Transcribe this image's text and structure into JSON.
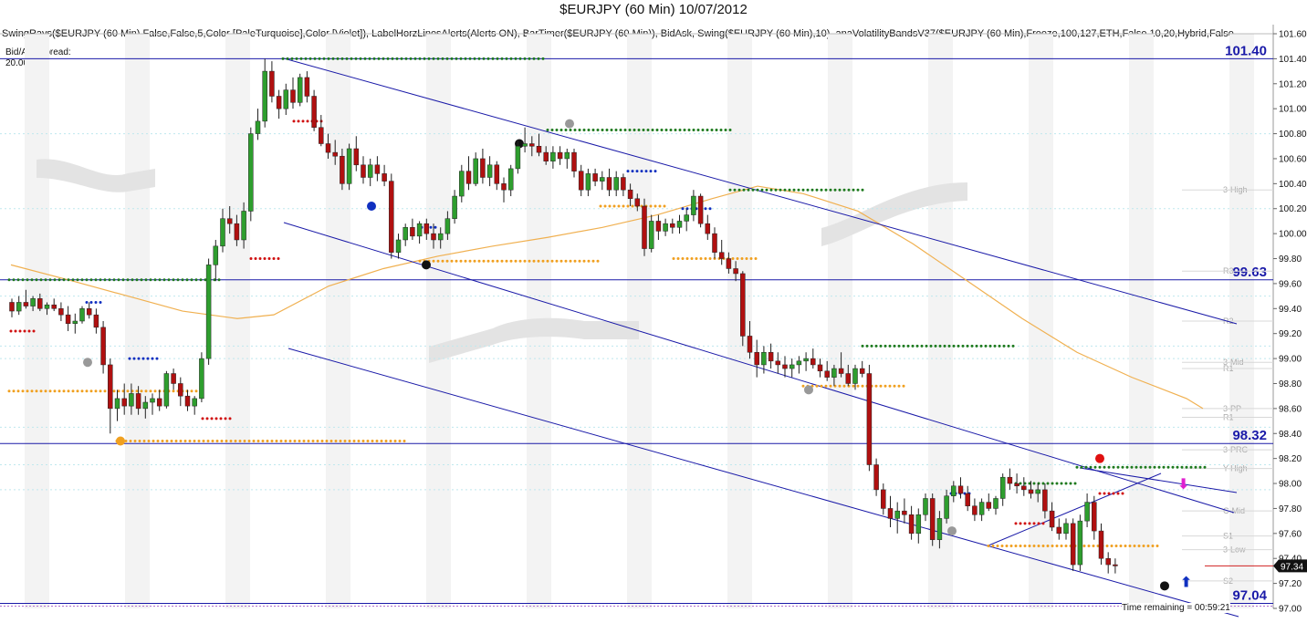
{
  "title": "$EURJPY (60 Min)  10/07/2012",
  "indicators_text": "SwingRays($EURJPY (60 Min),False,False,5,Color [PaleTurquoise],Color [Violet]), LabelHorzLinesAlerts(Alerts ON), BarTimer($EURJPY (60 Min)), BidAsk, Swing($EURJPY (60 Min),10), anaVolatilityBandsV37($EURJPY (60 Min),Freeze,100,127,ETH,False,10,20,Hybrid,False",
  "spread_label": "Bid/Ask Spread:",
  "spread_value": "20.00",
  "time_remaining": "Time remaining = 00:59:21",
  "colors": {
    "up": "#2e9e2e",
    "down": "#b01010",
    "channel": "#1a1aa8",
    "ma": "#f0b050",
    "green_dots": "#1e7a1e",
    "red_dots": "#d01010",
    "blue_dots": "#1030c0",
    "orange_dots": "#f0a020"
  },
  "chart_data": {
    "type": "candlestick",
    "symbol": "$EURJPY",
    "interval": "60 Min",
    "date": "10/07/2012",
    "ylim": [
      97.0,
      101.6
    ],
    "yticks": [
      "101.60",
      "101.40",
      "101.20",
      "101.00",
      "100.80",
      "100.60",
      "100.40",
      "100.20",
      "100.00",
      "99.80",
      "99.60",
      "99.40",
      "99.20",
      "99.00",
      "98.80",
      "98.60",
      "98.40",
      "98.20",
      "98.00",
      "97.80",
      "97.60",
      "97.40",
      "97.20",
      "97.00"
    ],
    "last_price": "97.34",
    "horizontal_levels": [
      {
        "label": "101.40",
        "value": 101.4
      },
      {
        "label": "99.63",
        "value": 99.63
      },
      {
        "label": "98.32",
        "value": 98.32
      },
      {
        "label": "97.04",
        "value": 97.04
      }
    ],
    "pivot_labels": [
      {
        "text": "3-High",
        "value": 100.35
      },
      {
        "text": "R3",
        "value": 99.7
      },
      {
        "text": "R2",
        "value": 99.3
      },
      {
        "text": "3-Mid",
        "value": 98.97
      },
      {
        "text": "R1",
        "value": 98.92
      },
      {
        "text": "3-PP",
        "value": 98.6
      },
      {
        "text": "R1",
        "value": 98.53
      },
      {
        "text": "3-PRC",
        "value": 98.27
      },
      {
        "text": "Y-High",
        "value": 98.12
      },
      {
        "text": "C-Mid",
        "value": 97.78
      },
      {
        "text": "S1",
        "value": 97.58
      },
      {
        "text": "3-Low",
        "value": 97.47
      },
      {
        "text": "S2",
        "value": 97.22
      }
    ],
    "candles": [
      [
        99.45,
        99.48,
        99.33,
        99.38
      ],
      [
        99.38,
        99.5,
        99.35,
        99.45
      ],
      [
        99.45,
        99.55,
        99.4,
        99.42
      ],
      [
        99.42,
        99.5,
        99.38,
        99.48
      ],
      [
        99.48,
        99.52,
        99.38,
        99.4
      ],
      [
        99.4,
        99.45,
        99.35,
        99.43
      ],
      [
        99.43,
        99.48,
        99.38,
        99.4
      ],
      [
        99.4,
        99.45,
        99.3,
        99.35
      ],
      [
        99.35,
        99.42,
        99.22,
        99.28
      ],
      [
        99.28,
        99.36,
        99.2,
        99.3
      ],
      [
        99.3,
        99.42,
        99.28,
        99.4
      ],
      [
        99.4,
        99.45,
        99.32,
        99.35
      ],
      [
        99.35,
        99.4,
        99.2,
        99.25
      ],
      [
        99.25,
        99.3,
        98.88,
        98.95
      ],
      [
        98.95,
        99.0,
        98.4,
        98.6
      ],
      [
        98.6,
        98.75,
        98.5,
        98.68
      ],
      [
        98.68,
        98.8,
        98.55,
        98.62
      ],
      [
        98.62,
        98.8,
        98.55,
        98.72
      ],
      [
        98.72,
        98.78,
        98.55,
        98.6
      ],
      [
        98.6,
        98.7,
        98.52,
        98.65
      ],
      [
        98.65,
        98.72,
        98.55,
        98.68
      ],
      [
        98.68,
        98.75,
        98.58,
        98.62
      ],
      [
        98.62,
        98.9,
        98.6,
        98.88
      ],
      [
        98.88,
        98.92,
        98.75,
        98.8
      ],
      [
        98.8,
        98.85,
        98.62,
        98.7
      ],
      [
        98.7,
        98.75,
        98.58,
        98.62
      ],
      [
        98.62,
        98.7,
        98.55,
        98.68
      ],
      [
        98.68,
        99.05,
        98.65,
        99.0
      ],
      [
        99.0,
        99.8,
        98.95,
        99.75
      ],
      [
        99.75,
        99.95,
        99.62,
        99.9
      ],
      [
        99.9,
        100.2,
        99.85,
        100.12
      ],
      [
        100.12,
        100.22,
        100.0,
        100.08
      ],
      [
        100.08,
        100.15,
        99.9,
        99.95
      ],
      [
        99.95,
        100.25,
        99.88,
        100.18
      ],
      [
        100.18,
        100.85,
        100.1,
        100.8
      ],
      [
        100.8,
        101.0,
        100.75,
        100.9
      ],
      [
        100.9,
        101.4,
        100.85,
        101.3
      ],
      [
        101.3,
        101.38,
        101.05,
        101.1
      ],
      [
        101.1,
        101.15,
        100.92,
        101.0
      ],
      [
        101.0,
        101.2,
        100.95,
        101.15
      ],
      [
        101.15,
        101.25,
        101.0,
        101.05
      ],
      [
        101.05,
        101.28,
        101.02,
        101.25
      ],
      [
        101.25,
        101.3,
        101.05,
        101.1
      ],
      [
        101.1,
        101.15,
        100.82,
        100.85
      ],
      [
        100.85,
        100.95,
        100.7,
        100.72
      ],
      [
        100.72,
        100.8,
        100.6,
        100.65
      ],
      [
        100.65,
        100.75,
        100.55,
        100.62
      ],
      [
        100.62,
        100.68,
        100.35,
        100.4
      ],
      [
        100.4,
        100.72,
        100.35,
        100.68
      ],
      [
        100.68,
        100.78,
        100.5,
        100.55
      ],
      [
        100.55,
        100.62,
        100.4,
        100.45
      ],
      [
        100.45,
        100.6,
        100.38,
        100.55
      ],
      [
        100.55,
        100.62,
        100.42,
        100.48
      ],
      [
        100.48,
        100.55,
        100.38,
        100.42
      ],
      [
        100.42,
        100.48,
        99.8,
        99.85
      ],
      [
        99.85,
        100.0,
        99.8,
        99.95
      ],
      [
        99.95,
        100.08,
        99.9,
        100.05
      ],
      [
        100.05,
        100.12,
        99.95,
        99.98
      ],
      [
        99.98,
        100.1,
        99.92,
        100.08
      ],
      [
        100.08,
        100.12,
        99.95,
        100.0
      ],
      [
        100.0,
        100.08,
        99.88,
        99.95
      ],
      [
        99.95,
        100.05,
        99.88,
        100.0
      ],
      [
        100.0,
        100.18,
        99.95,
        100.12
      ],
      [
        100.12,
        100.35,
        100.08,
        100.3
      ],
      [
        100.3,
        100.55,
        100.25,
        100.5
      ],
      [
        100.5,
        100.62,
        100.35,
        100.4
      ],
      [
        100.4,
        100.65,
        100.38,
        100.6
      ],
      [
        100.6,
        100.68,
        100.4,
        100.45
      ],
      [
        100.45,
        100.62,
        100.38,
        100.55
      ],
      [
        100.55,
        100.58,
        100.35,
        100.4
      ],
      [
        100.4,
        100.45,
        100.25,
        100.35
      ],
      [
        100.35,
        100.55,
        100.3,
        100.52
      ],
      [
        100.52,
        100.75,
        100.48,
        100.7
      ],
      [
        100.7,
        100.85,
        100.65,
        100.72
      ],
      [
        100.72,
        100.78,
        100.62,
        100.7
      ],
      [
        100.7,
        100.8,
        100.62,
        100.65
      ],
      [
        100.65,
        100.7,
        100.55,
        100.58
      ],
      [
        100.58,
        100.7,
        100.52,
        100.65
      ],
      [
        100.65,
        100.7,
        100.55,
        100.6
      ],
      [
        100.6,
        100.68,
        100.52,
        100.65
      ],
      [
        100.65,
        100.68,
        100.45,
        100.5
      ],
      [
        100.5,
        100.55,
        100.3,
        100.35
      ],
      [
        100.35,
        100.52,
        100.3,
        100.48
      ],
      [
        100.48,
        100.52,
        100.38,
        100.42
      ],
      [
        100.42,
        100.5,
        100.35,
        100.45
      ],
      [
        100.45,
        100.52,
        100.3,
        100.35
      ],
      [
        100.35,
        100.5,
        100.3,
        100.45
      ],
      [
        100.45,
        100.48,
        100.3,
        100.35
      ],
      [
        100.35,
        100.4,
        100.22,
        100.28
      ],
      [
        100.28,
        100.32,
        100.18,
        100.22
      ],
      [
        100.22,
        100.28,
        99.82,
        99.88
      ],
      [
        99.88,
        100.15,
        99.85,
        100.1
      ],
      [
        100.1,
        100.15,
        99.95,
        100.02
      ],
      [
        100.02,
        100.12,
        99.98,
        100.08
      ],
      [
        100.08,
        100.12,
        100.0,
        100.05
      ],
      [
        100.05,
        100.15,
        100.0,
        100.1
      ],
      [
        100.1,
        100.2,
        100.02,
        100.15
      ],
      [
        100.15,
        100.35,
        100.1,
        100.3
      ],
      [
        100.3,
        100.32,
        100.05,
        100.08
      ],
      [
        100.08,
        100.15,
        99.95,
        100.0
      ],
      [
        100.0,
        100.05,
        99.8,
        99.85
      ],
      [
        99.85,
        99.95,
        99.75,
        99.8
      ],
      [
        99.8,
        99.85,
        99.68,
        99.72
      ],
      [
        99.72,
        99.78,
        99.62,
        99.68
      ],
      [
        99.68,
        99.7,
        99.1,
        99.18
      ],
      [
        99.18,
        99.3,
        99.0,
        99.05
      ],
      [
        99.05,
        99.15,
        98.85,
        98.95
      ],
      [
        98.95,
        99.1,
        98.88,
        99.05
      ],
      [
        99.05,
        99.12,
        98.92,
        98.98
      ],
      [
        98.98,
        99.05,
        98.88,
        98.95
      ],
      [
        98.95,
        99.02,
        98.85,
        98.92
      ],
      [
        98.92,
        99.0,
        98.85,
        98.95
      ],
      [
        98.95,
        99.02,
        98.88,
        98.98
      ],
      [
        98.98,
        99.05,
        98.9,
        99.0
      ],
      [
        99.0,
        99.08,
        98.92,
        98.95
      ],
      [
        98.95,
        99.0,
        98.85,
        98.9
      ],
      [
        98.9,
        98.98,
        98.82,
        98.85
      ],
      [
        98.85,
        98.95,
        98.78,
        98.92
      ],
      [
        98.92,
        99.05,
        98.85,
        98.88
      ],
      [
        98.88,
        98.95,
        98.78,
        98.8
      ],
      [
        98.8,
        98.95,
        98.75,
        98.92
      ],
      [
        98.92,
        98.98,
        98.85,
        98.88
      ],
      [
        98.88,
        98.95,
        98.1,
        98.15
      ],
      [
        98.15,
        98.2,
        97.9,
        97.95
      ],
      [
        97.95,
        98.0,
        97.75,
        97.8
      ],
      [
        97.8,
        97.9,
        97.65,
        97.72
      ],
      [
        97.72,
        97.85,
        97.6,
        97.78
      ],
      [
        97.78,
        97.88,
        97.68,
        97.75
      ],
      [
        97.75,
        97.82,
        97.55,
        97.6
      ],
      [
        97.6,
        97.8,
        97.52,
        97.75
      ],
      [
        97.75,
        97.92,
        97.7,
        97.88
      ],
      [
        97.88,
        97.92,
        97.5,
        97.55
      ],
      [
        97.55,
        97.78,
        97.48,
        97.72
      ],
      [
        97.72,
        97.95,
        97.68,
        97.9
      ],
      [
        97.9,
        98.02,
        97.85,
        97.98
      ],
      [
        97.98,
        98.05,
        97.88,
        97.92
      ],
      [
        97.92,
        97.98,
        97.78,
        97.82
      ],
      [
        97.82,
        97.88,
        97.7,
        97.75
      ],
      [
        97.75,
        97.88,
        97.7,
        97.85
      ],
      [
        97.85,
        97.92,
        97.78,
        97.8
      ],
      [
        97.8,
        97.9,
        97.75,
        97.88
      ],
      [
        97.88,
        98.08,
        97.82,
        98.05
      ],
      [
        98.05,
        98.12,
        97.95,
        98.0
      ],
      [
        98.0,
        98.08,
        97.92,
        97.98
      ],
      [
        97.98,
        98.05,
        97.9,
        97.95
      ],
      [
        97.95,
        98.02,
        97.88,
        97.92
      ],
      [
        97.92,
        98.0,
        97.85,
        97.95
      ],
      [
        97.95,
        98.0,
        97.72,
        97.78
      ],
      [
        97.78,
        97.85,
        97.62,
        97.65
      ],
      [
        97.65,
        97.72,
        97.55,
        97.6
      ],
      [
        97.6,
        97.72,
        97.55,
        97.68
      ],
      [
        97.68,
        97.72,
        97.3,
        97.35
      ],
      [
        97.35,
        97.75,
        97.3,
        97.7
      ],
      [
        97.7,
        97.92,
        97.65,
        97.85
      ],
      [
        97.85,
        97.9,
        97.55,
        97.62
      ],
      [
        97.62,
        97.68,
        97.35,
        97.4
      ],
      [
        97.4,
        97.45,
        97.28,
        97.35
      ],
      [
        97.35,
        97.4,
        97.28,
        97.34
      ]
    ]
  }
}
